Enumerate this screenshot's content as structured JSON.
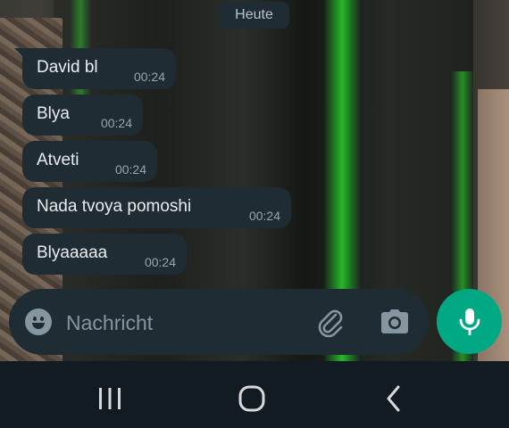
{
  "date_separator": "Heute",
  "messages": [
    {
      "text": "David bl",
      "time": "00:24"
    },
    {
      "text": "Blya",
      "time": "00:24"
    },
    {
      "text": "Atveti",
      "time": "00:24"
    },
    {
      "text": "Nada tvoya pomoshi",
      "time": "00:24"
    },
    {
      "text": "Blyaaaaa",
      "time": "00:24"
    }
  ],
  "composer": {
    "placeholder": "Nachricht",
    "value": "",
    "icons": {
      "emoji": "emoji-icon",
      "attach": "paperclip-icon",
      "camera": "camera-icon",
      "mic": "microphone-icon"
    }
  },
  "navigation": {
    "icons": [
      "recents-icon",
      "home-icon",
      "back-icon"
    ]
  },
  "colors": {
    "bubble": "#1f2c33",
    "accent": "#00a884",
    "nav_background": "#111b21"
  }
}
